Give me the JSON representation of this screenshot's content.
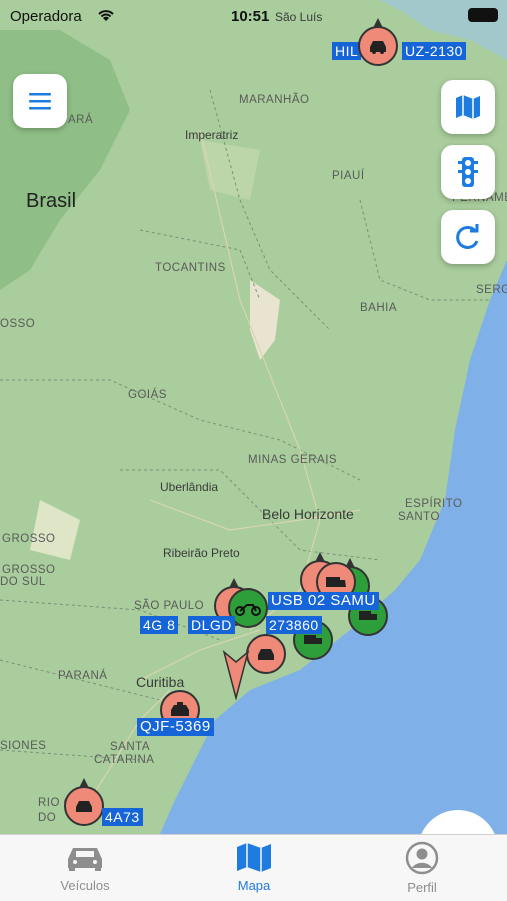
{
  "status_bar": {
    "carrier": "Operadora",
    "time": "10:51"
  },
  "map": {
    "regions": [
      "MARANHÃO",
      "PIAUÍ",
      "PERNAMBU",
      "ARÁ",
      "TOCANTINS",
      "BAHIA",
      "GOIÁS",
      "MINAS GERAIS",
      "ESPÍRITO",
      "SANTO",
      "SÃO PAULO",
      "PARANÁ",
      "SANTA",
      "CATARINA",
      "RIO G",
      "DO",
      "GROSSO",
      "GROSSO",
      "OSSO",
      "DO SUL",
      "SIONES",
      "SERG"
    ],
    "country": "Brasil",
    "cities": [
      "São Luís",
      "Imperatriz",
      "Uberlândia",
      "Belo Horizonte",
      "Ribeirão Preto",
      "Curitiba"
    ]
  },
  "vehicles": [
    {
      "label": "HIL",
      "label2": "UZ-2130",
      "color": "red",
      "icon": "car-icon"
    },
    {
      "label": "USB 02 SAMU",
      "color": "red",
      "icon": "ambulance-icon"
    },
    {
      "label": "4G 8",
      "label2": "DLGD",
      "label3": "273860",
      "color": "green",
      "icon": "motorcycle-icon"
    },
    {
      "label": "QJF-5369",
      "color": "red",
      "icon": "taxi-icon"
    },
    {
      "label": "4A73",
      "color": "red",
      "icon": "car-icon"
    }
  ],
  "buttons": {
    "menu": "menu-icon",
    "map_type": "map-icon",
    "traffic": "traffic-light-icon",
    "refresh": "refresh-icon"
  },
  "tabs": [
    {
      "label": "Veículos",
      "icon": "car-icon",
      "active": false
    },
    {
      "label": "Mapa",
      "icon": "map-icon",
      "active": true
    },
    {
      "label": "Perfil",
      "icon": "person-icon",
      "active": false
    }
  ],
  "colors": {
    "accent": "#1e7be0",
    "vehicle_label_bg": "#1565d8",
    "marker_red": "#f08a78",
    "marker_green": "#2e9e3a",
    "ocean": "#7fb0e8"
  }
}
